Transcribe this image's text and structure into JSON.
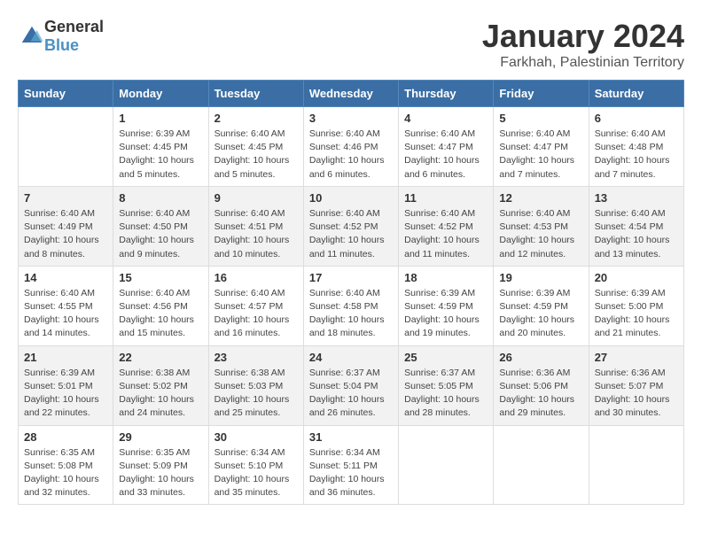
{
  "logo": {
    "general": "General",
    "blue": "Blue"
  },
  "title": "January 2024",
  "subtitle": "Farkhah, Palestinian Territory",
  "headers": [
    "Sunday",
    "Monday",
    "Tuesday",
    "Wednesday",
    "Thursday",
    "Friday",
    "Saturday"
  ],
  "weeks": [
    [
      {
        "date": "",
        "info": ""
      },
      {
        "date": "1",
        "info": "Sunrise: 6:39 AM\nSunset: 4:45 PM\nDaylight: 10 hours\nand 5 minutes."
      },
      {
        "date": "2",
        "info": "Sunrise: 6:40 AM\nSunset: 4:45 PM\nDaylight: 10 hours\nand 5 minutes."
      },
      {
        "date": "3",
        "info": "Sunrise: 6:40 AM\nSunset: 4:46 PM\nDaylight: 10 hours\nand 6 minutes."
      },
      {
        "date": "4",
        "info": "Sunrise: 6:40 AM\nSunset: 4:47 PM\nDaylight: 10 hours\nand 6 minutes."
      },
      {
        "date": "5",
        "info": "Sunrise: 6:40 AM\nSunset: 4:47 PM\nDaylight: 10 hours\nand 7 minutes."
      },
      {
        "date": "6",
        "info": "Sunrise: 6:40 AM\nSunset: 4:48 PM\nDaylight: 10 hours\nand 7 minutes."
      }
    ],
    [
      {
        "date": "7",
        "info": "Sunrise: 6:40 AM\nSunset: 4:49 PM\nDaylight: 10 hours\nand 8 minutes."
      },
      {
        "date": "8",
        "info": "Sunrise: 6:40 AM\nSunset: 4:50 PM\nDaylight: 10 hours\nand 9 minutes."
      },
      {
        "date": "9",
        "info": "Sunrise: 6:40 AM\nSunset: 4:51 PM\nDaylight: 10 hours\nand 10 minutes."
      },
      {
        "date": "10",
        "info": "Sunrise: 6:40 AM\nSunset: 4:52 PM\nDaylight: 10 hours\nand 11 minutes."
      },
      {
        "date": "11",
        "info": "Sunrise: 6:40 AM\nSunset: 4:52 PM\nDaylight: 10 hours\nand 11 minutes."
      },
      {
        "date": "12",
        "info": "Sunrise: 6:40 AM\nSunset: 4:53 PM\nDaylight: 10 hours\nand 12 minutes."
      },
      {
        "date": "13",
        "info": "Sunrise: 6:40 AM\nSunset: 4:54 PM\nDaylight: 10 hours\nand 13 minutes."
      }
    ],
    [
      {
        "date": "14",
        "info": "Sunrise: 6:40 AM\nSunset: 4:55 PM\nDaylight: 10 hours\nand 14 minutes."
      },
      {
        "date": "15",
        "info": "Sunrise: 6:40 AM\nSunset: 4:56 PM\nDaylight: 10 hours\nand 15 minutes."
      },
      {
        "date": "16",
        "info": "Sunrise: 6:40 AM\nSunset: 4:57 PM\nDaylight: 10 hours\nand 16 minutes."
      },
      {
        "date": "17",
        "info": "Sunrise: 6:40 AM\nSunset: 4:58 PM\nDaylight: 10 hours\nand 18 minutes."
      },
      {
        "date": "18",
        "info": "Sunrise: 6:39 AM\nSunset: 4:59 PM\nDaylight: 10 hours\nand 19 minutes."
      },
      {
        "date": "19",
        "info": "Sunrise: 6:39 AM\nSunset: 4:59 PM\nDaylight: 10 hours\nand 20 minutes."
      },
      {
        "date": "20",
        "info": "Sunrise: 6:39 AM\nSunset: 5:00 PM\nDaylight: 10 hours\nand 21 minutes."
      }
    ],
    [
      {
        "date": "21",
        "info": "Sunrise: 6:39 AM\nSunset: 5:01 PM\nDaylight: 10 hours\nand 22 minutes."
      },
      {
        "date": "22",
        "info": "Sunrise: 6:38 AM\nSunset: 5:02 PM\nDaylight: 10 hours\nand 24 minutes."
      },
      {
        "date": "23",
        "info": "Sunrise: 6:38 AM\nSunset: 5:03 PM\nDaylight: 10 hours\nand 25 minutes."
      },
      {
        "date": "24",
        "info": "Sunrise: 6:37 AM\nSunset: 5:04 PM\nDaylight: 10 hours\nand 26 minutes."
      },
      {
        "date": "25",
        "info": "Sunrise: 6:37 AM\nSunset: 5:05 PM\nDaylight: 10 hours\nand 28 minutes."
      },
      {
        "date": "26",
        "info": "Sunrise: 6:36 AM\nSunset: 5:06 PM\nDaylight: 10 hours\nand 29 minutes."
      },
      {
        "date": "27",
        "info": "Sunrise: 6:36 AM\nSunset: 5:07 PM\nDaylight: 10 hours\nand 30 minutes."
      }
    ],
    [
      {
        "date": "28",
        "info": "Sunrise: 6:35 AM\nSunset: 5:08 PM\nDaylight: 10 hours\nand 32 minutes."
      },
      {
        "date": "29",
        "info": "Sunrise: 6:35 AM\nSunset: 5:09 PM\nDaylight: 10 hours\nand 33 minutes."
      },
      {
        "date": "30",
        "info": "Sunrise: 6:34 AM\nSunset: 5:10 PM\nDaylight: 10 hours\nand 35 minutes."
      },
      {
        "date": "31",
        "info": "Sunrise: 6:34 AM\nSunset: 5:11 PM\nDaylight: 10 hours\nand 36 minutes."
      },
      {
        "date": "",
        "info": ""
      },
      {
        "date": "",
        "info": ""
      },
      {
        "date": "",
        "info": ""
      }
    ]
  ]
}
